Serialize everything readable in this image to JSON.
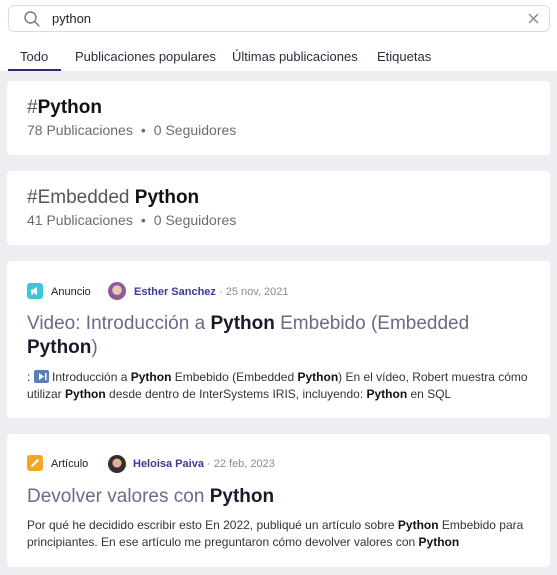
{
  "search": {
    "value": "python"
  },
  "tabs": [
    {
      "label": "Todo"
    },
    {
      "label": "Publicaciones populares"
    },
    {
      "label": "Últimas publicaciones"
    },
    {
      "label": "Etiquetas"
    }
  ],
  "tags": [
    {
      "prefix": "#",
      "name_plain": "",
      "name_bold": "Python",
      "posts": "78 Publicaciones",
      "followers": "0 Seguidores"
    },
    {
      "prefix": "#",
      "name_plain": "Embedded ",
      "name_bold": "Python",
      "posts": "41 Publicaciones",
      "followers": "0 Seguidores"
    }
  ],
  "posts": [
    {
      "type": "Anuncio",
      "type_color": "#3cc6d8",
      "author": "Esther Sanchez",
      "date": "· 25 nov, 2021",
      "title_1": "Video: Introducción a ",
      "title_2": "Python",
      "title_3": " Embebido (Embedded ",
      "title_4": "Python",
      "title_5": ")",
      "body_1": ": ",
      "body_icon": "play-video-icon",
      "body_2": " Introducción a ",
      "body_3": "Python",
      "body_4": " Embebido (Embedded ",
      "body_5": "Python",
      "body_6": ") En el vídeo, Robert muestra cómo utilizar ",
      "body_7": "Python",
      "body_8": " desde dentro de InterSystems IRIS, incluyendo: ",
      "body_9": "Python",
      "body_10": " en SQL"
    },
    {
      "type": "Artículo",
      "type_color": "#f5a623",
      "author": "Heloisa Paiva",
      "date": "· 22 feb, 2023",
      "title_1": "Devolver valores con ",
      "title_2": "Python",
      "body_1": "Por qué he decidido escribir esto En 2022, publiqué un artículo sobre ",
      "body_2": "Python",
      "body_3": " Embebido para principiantes. En ese artículo me preguntaron cómo devolver valores con ",
      "body_4": "Python"
    }
  ],
  "colors": {
    "accent": "#2d2a6e",
    "author": "#3a3a9a"
  }
}
